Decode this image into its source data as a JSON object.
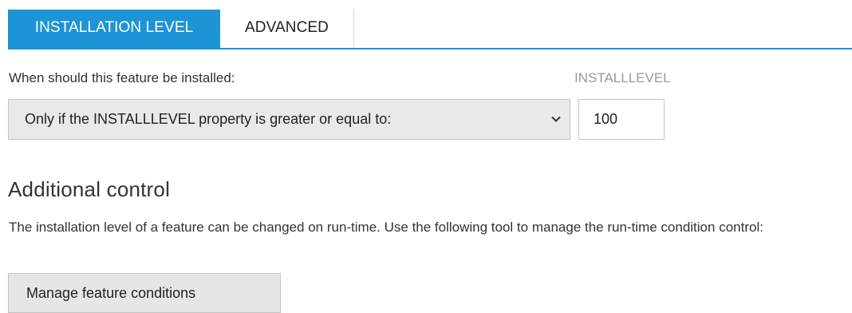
{
  "tabs": [
    {
      "label": "INSTALLATION LEVEL",
      "active": true
    },
    {
      "label": "ADVANCED",
      "active": false
    }
  ],
  "install_condition": {
    "label": "When should this feature be installed:",
    "selected": "Only if the INSTALLLEVEL property is greater or equal to:"
  },
  "install_level": {
    "label": "INSTALLLEVEL",
    "value": "100"
  },
  "additional_control": {
    "title": "Additional control",
    "description": "The installation level of a feature can be changed on run-time. Use the following tool to manage the run-time condition control:",
    "button_label": "Manage feature conditions"
  },
  "colors": {
    "accent": "#1c94d6",
    "control_bg": "#e9e9e9",
    "border": "#c4c4c4",
    "muted_label": "#9a9a9a"
  },
  "icons": {
    "select_chevron": "chevron-down-icon"
  }
}
